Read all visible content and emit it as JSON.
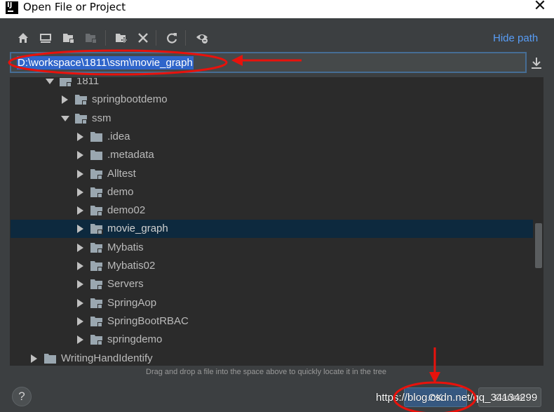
{
  "window": {
    "title": "Open File or Project",
    "close_glyph": "✕",
    "app_icon": "IJ"
  },
  "toolbar": {
    "buttons": [
      "home-icon",
      "desktop-icon",
      "project-folder-icon",
      "module-folder-icon",
      "new-folder-icon",
      "delete-icon",
      "refresh-icon",
      "show-hidden-icon"
    ],
    "hide_path_label": "Hide path"
  },
  "path_field": {
    "value": "D:\\workspace\\1811\\ssm\\movie_graph"
  },
  "tree": {
    "items": [
      {
        "label": "1811",
        "level": 2,
        "expanded": true
      },
      {
        "label": "springbootdemo",
        "level": 3,
        "expanded": false
      },
      {
        "label": "ssm",
        "level": 3,
        "expanded": true
      },
      {
        "label": ".idea",
        "level": 4,
        "expanded": false
      },
      {
        "label": ".metadata",
        "level": 4,
        "expanded": false
      },
      {
        "label": "Alltest",
        "level": 4,
        "expanded": false
      },
      {
        "label": "demo",
        "level": 4,
        "expanded": false
      },
      {
        "label": "demo02",
        "level": 4,
        "expanded": false
      },
      {
        "label": "movie_graph",
        "level": 4,
        "expanded": false,
        "selected": true
      },
      {
        "label": "Mybatis",
        "level": 4,
        "expanded": false
      },
      {
        "label": "Mybatis02",
        "level": 4,
        "expanded": false
      },
      {
        "label": "Servers",
        "level": 4,
        "expanded": false
      },
      {
        "label": "SpringAop",
        "level": 4,
        "expanded": false
      },
      {
        "label": "SpringBootRBAC",
        "level": 4,
        "expanded": false
      },
      {
        "label": "springdemo",
        "level": 4,
        "expanded": false
      },
      {
        "label": "WritingHandIdentify",
        "level": 1,
        "expanded": false
      }
    ]
  },
  "hint": "Drag and drop a file into the space above to quickly locate it in the tree",
  "footer": {
    "help_label": "?",
    "ok_label": "OK",
    "cancel_label": "Cancel"
  },
  "watermark": "https://blog.csdn.net/qq_34134299",
  "colors": {
    "background": "#3c3f41",
    "tree_background": "#2b2b2b",
    "selection": "#0d293e",
    "link": "#589df6",
    "annotation": "#e8120c"
  }
}
